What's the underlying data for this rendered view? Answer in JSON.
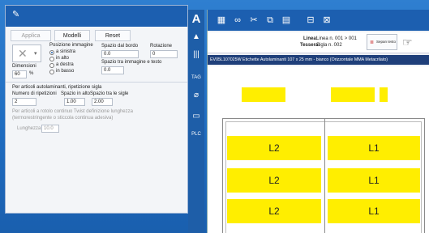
{
  "left_panel": {
    "buttons": {
      "applica": "Applica",
      "modelli": "Modelli",
      "reset": "Reset"
    },
    "dimensions": {
      "label": "Dimensioni",
      "value": "60",
      "unit": "%"
    },
    "image_position": {
      "label": "Posizione immagine",
      "options": [
        "a sinistra",
        "in alto",
        "a destra",
        "in basso"
      ],
      "selected": "a sinistra"
    },
    "border_space": {
      "label": "Spazio dal bordo",
      "value": "0.0"
    },
    "rotation": {
      "label": "Rotazione",
      "value": "0"
    },
    "image_text_space": {
      "label": "Spazio tra immagine e testo",
      "value": "0.0"
    },
    "self_lam": {
      "heading": "Per articoli autolaminanti, ripetizione sigla",
      "repetitions_label": "Numero di ripetizioni",
      "repetitions_value": "2",
      "space_top_label": "Spazio in alto",
      "space_top_value": "1.00",
      "space_between_label": "Spazio tra le sigle",
      "space_between_value": "2.00"
    },
    "continuous": {
      "heading": "Per articoli a rotolo continuo Twist definizione lunghezza",
      "subheading": "(termorestringente o sticcola continua adesiva)",
      "length_label": "Lunghezza",
      "length_value": "10.0"
    }
  },
  "tool_strip": {
    "icons": [
      "text-icon",
      "image-icon",
      "barcode-icon",
      "tag-icon",
      "symbol-icon",
      "frame-icon",
      "plc-icon"
    ],
    "labels": {
      "tag": "TAG",
      "plc": "PLC"
    }
  },
  "editor": {
    "toolbar_icons": [
      "grid-icon",
      "binoculars-icon",
      "scissors-icon",
      "copy-icon",
      "paste-icon",
      "split-icon",
      "clear-icon"
    ],
    "info": {
      "line_label": "Linea:",
      "line_value": "Linea n. 001 > 001",
      "sheet_label": "Tessera:",
      "sheet_value": "Sigla n. 002",
      "button_label": "Sepan testo"
    },
    "title": "EV05L107025W Etichette Autolaminanti 107 x 25 mm - bianco (Orizzontale MMA Metacrilato)",
    "labels_grid": {
      "rows": [
        [
          "L2",
          "L1"
        ],
        [
          "L2",
          "L1"
        ],
        [
          "L2",
          "L1"
        ]
      ]
    }
  },
  "colors": {
    "accent": "#1c5fb0",
    "label": "#ffee00",
    "title_bar": "#1f3f7a"
  }
}
